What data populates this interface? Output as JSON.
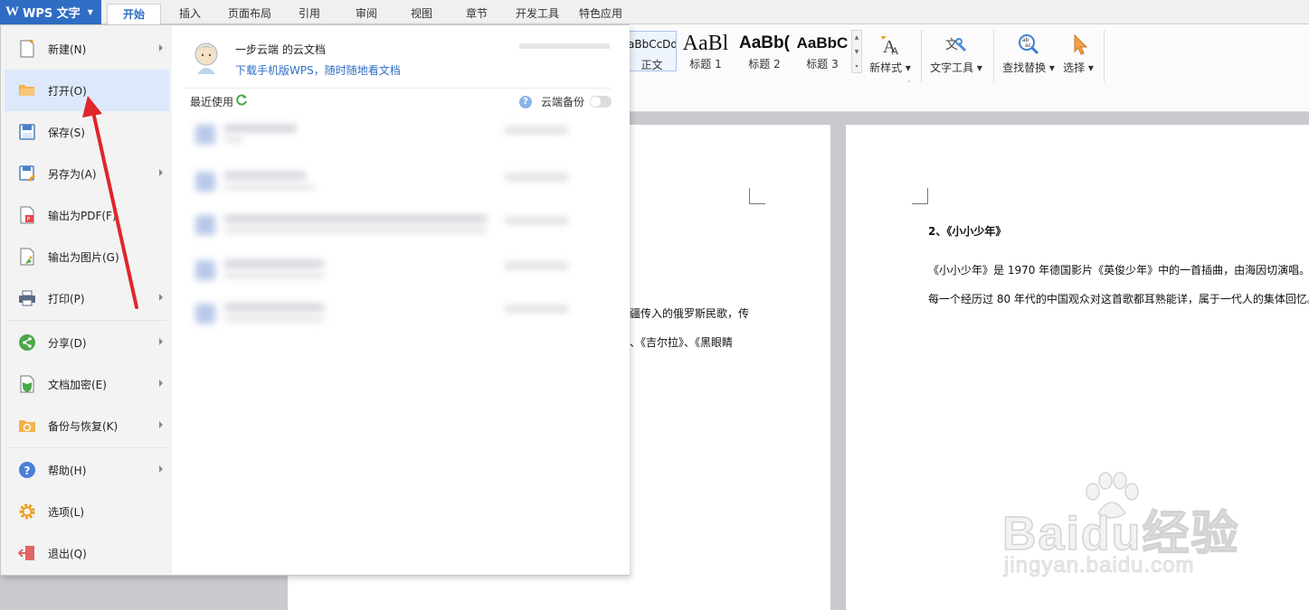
{
  "app": {
    "menu_button": "WPS 文字",
    "logo_letter": "W"
  },
  "tabs": [
    {
      "label": "开始",
      "active": true
    },
    {
      "label": "插入"
    },
    {
      "label": "页面布局"
    },
    {
      "label": "引用"
    },
    {
      "label": "审阅"
    },
    {
      "label": "视图"
    },
    {
      "label": "章节"
    },
    {
      "label": "开发工具"
    },
    {
      "label": "特色应用"
    }
  ],
  "ribbon": {
    "styles": [
      {
        "sample": "aBbCcDd",
        "label": "正文"
      },
      {
        "sample": "AaBl",
        "label": "标题 1"
      },
      {
        "sample": "AaBb(",
        "label": "标题 2"
      },
      {
        "sample": "AaBbC",
        "label": "标题 3"
      }
    ],
    "tools": [
      {
        "label": "新样式",
        "icon": "new-style-icon"
      },
      {
        "label": "文字工具",
        "icon": "text-tools-icon"
      },
      {
        "label": "查找替换",
        "icon": "find-replace-icon"
      },
      {
        "label": "选择",
        "icon": "select-cursor-icon"
      }
    ]
  },
  "file_menu": {
    "items": [
      {
        "label": "新建(N)",
        "icon": "new-document-icon",
        "submenu": true
      },
      {
        "label": "打开(O)",
        "icon": "open-folder-icon",
        "submenu": false,
        "highlighted": true
      },
      {
        "label": "保存(S)",
        "icon": "save-disk-icon",
        "submenu": false
      },
      {
        "label": "另存为(A)",
        "icon": "save-as-icon",
        "submenu": true
      },
      {
        "label": "输出为PDF(F)",
        "icon": "export-pdf-icon",
        "submenu": false
      },
      {
        "label": "输出为图片(G)",
        "icon": "export-image-icon",
        "submenu": false
      },
      {
        "label": "打印(P)",
        "icon": "printer-icon",
        "submenu": true
      },
      {
        "label": "分享(D)",
        "icon": "share-icon",
        "submenu": true
      },
      {
        "label": "文档加密(E)",
        "icon": "encrypt-document-icon",
        "submenu": true
      },
      {
        "label": "备份与恢复(K)",
        "icon": "backup-restore-icon",
        "submenu": true
      },
      {
        "label": "帮助(H)",
        "icon": "help-icon",
        "submenu": true
      },
      {
        "label": "选项(L)",
        "icon": "gear-icon",
        "submenu": false
      },
      {
        "label": "退出(Q)",
        "icon": "exit-icon",
        "submenu": false
      }
    ],
    "cloud": {
      "title": "一步云端 的云文档",
      "link": "下载手机版WPS，随时随地看文档"
    },
    "recent": {
      "header": "最近使用",
      "backup_label": "云端备份",
      "items": [
        {
          "name": "",
          "path": "",
          "date": ""
        },
        {
          "name": "",
          "path": "",
          "date": ""
        },
        {
          "name": "",
          "path": "",
          "date": ""
        },
        {
          "name": "",
          "path": "",
          "date": ""
        },
        {
          "name": "",
          "path": "",
          "date": ""
        }
      ]
    }
  },
  "document": {
    "page1_lines": [
      "疆传入的俄罗斯民歌，传",
      "、《吉尔拉》、《黑眼睛"
    ],
    "page2": {
      "heading": "2、《小小少年》",
      "line1": "《小小少年》是 1970 年德国影片《英俊少年》中的一首插曲，由海因切演唱。",
      "line2": "每一个经历过 80 年代的中国观众对这首歌都耳熟能详，属于一代人的集体回忆。"
    }
  },
  "watermark": {
    "main": "Baidu经验",
    "sub": "jingyan.baidu.com"
  },
  "colors": {
    "accent": "#2f6dc4",
    "annotation": "#e0262b",
    "hover": "#dde9fa"
  }
}
